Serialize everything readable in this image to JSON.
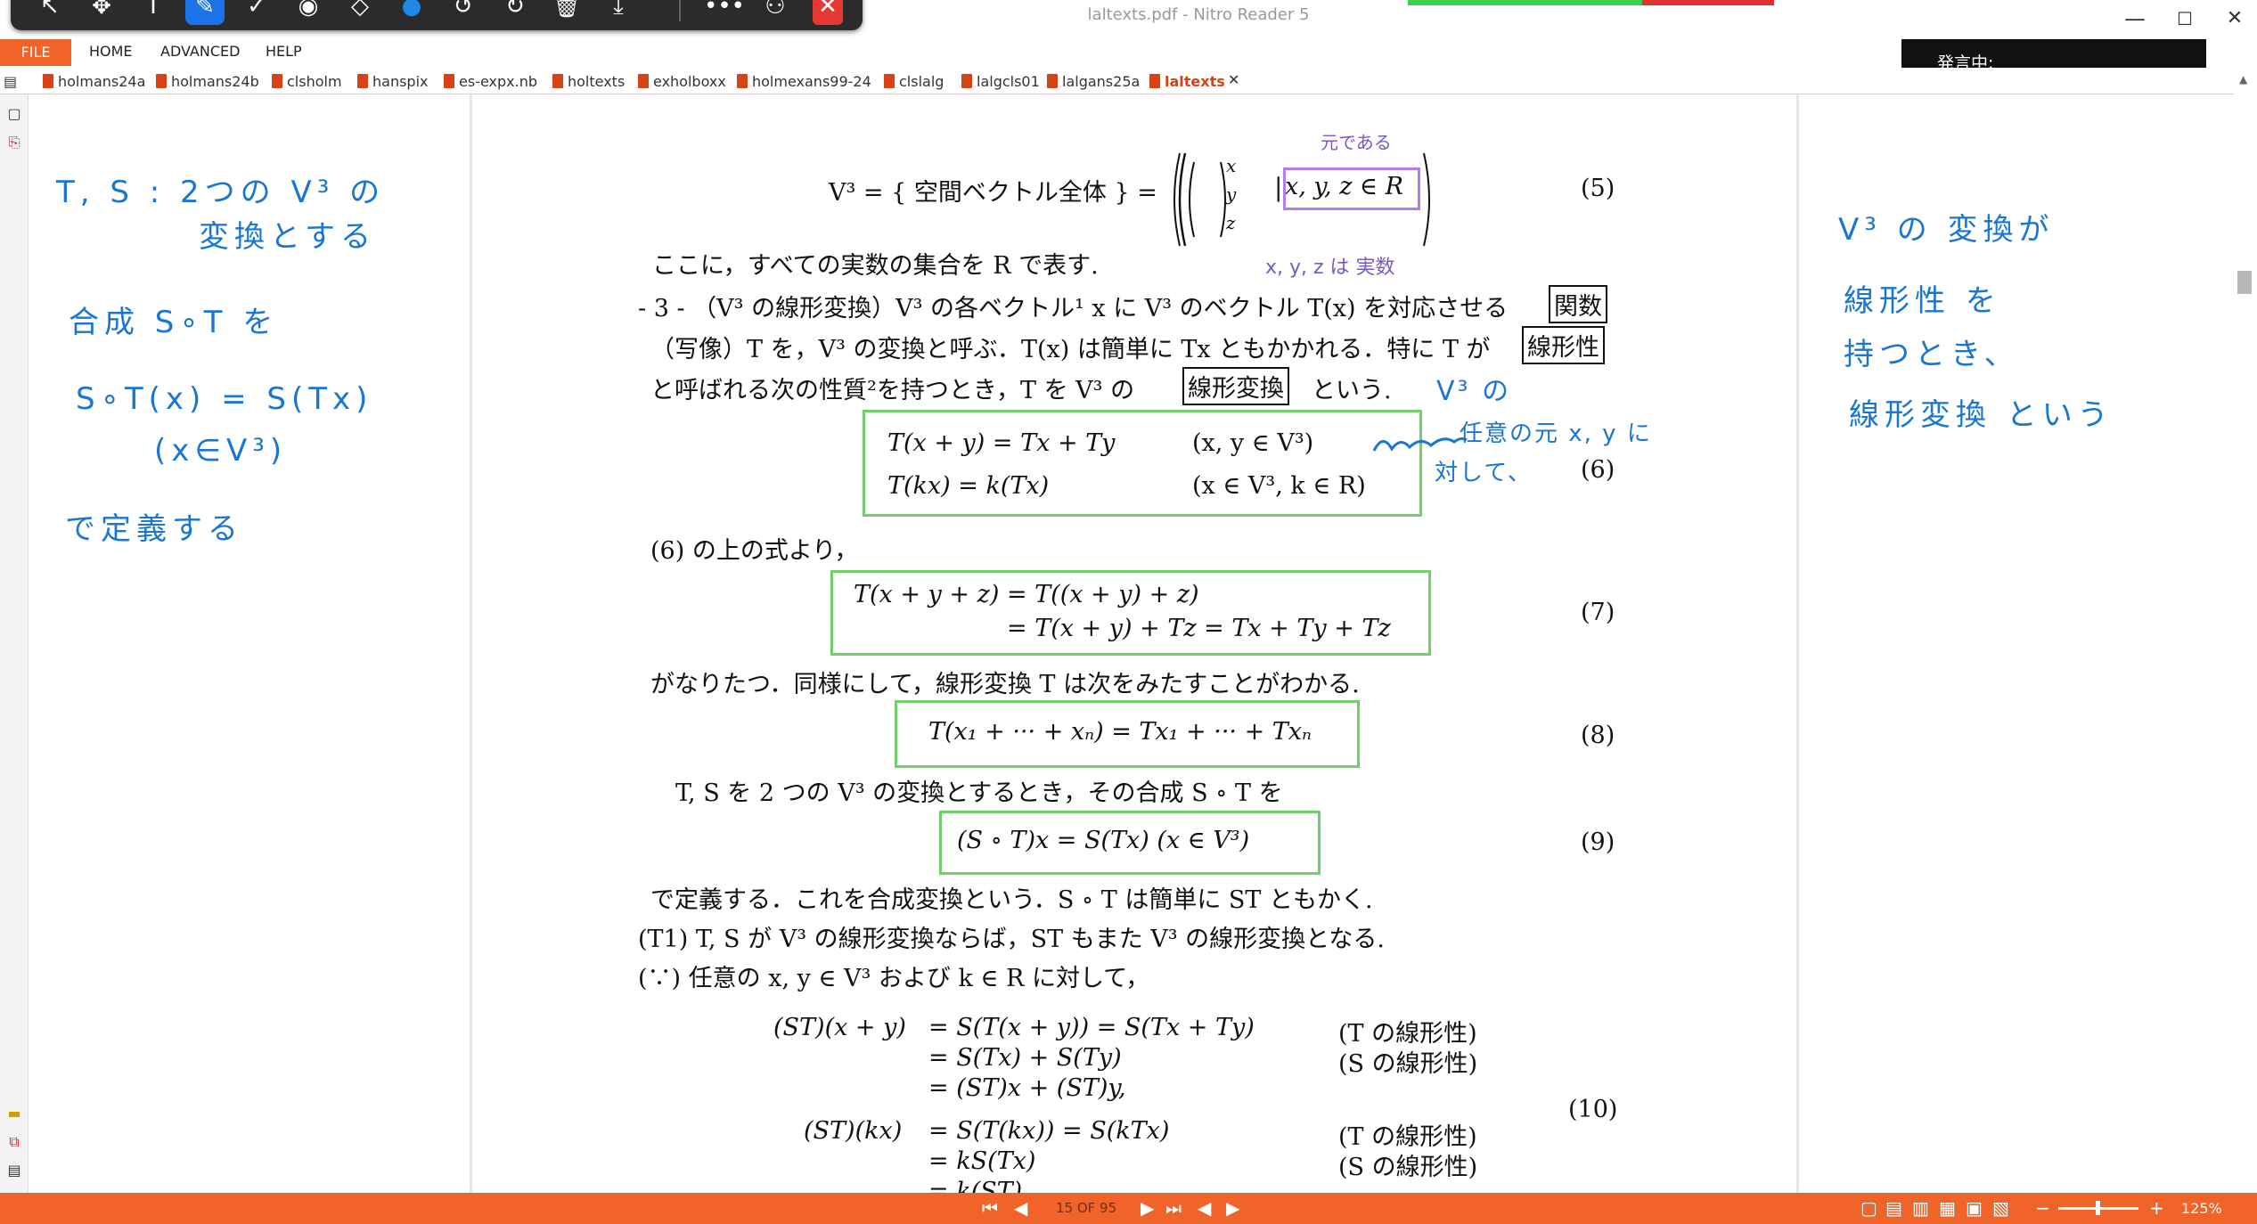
{
  "window": {
    "title": "laltexts.pdf - Nitro Reader 5",
    "minimize": "—",
    "maximize": "☐",
    "close": "✕"
  },
  "draw_toolbar": {
    "icons": [
      "pointer-icon",
      "move-icon",
      "text-cursor-icon",
      "pen-icon",
      "check-icon",
      "stamp-icon",
      "eraser-icon",
      "color-dot-icon",
      "undo-icon",
      "redo-icon",
      "delete-icon",
      "download-icon",
      "more-icon",
      "share-icon",
      "close-icon"
    ]
  },
  "menu": {
    "file": "FILE",
    "home": "HOME",
    "advanced": "ADVANCED",
    "help": "HELP"
  },
  "banner": "発言中:",
  "tabs": [
    "holmans24a",
    "holmans24b",
    "clsholm",
    "hanspix",
    "es-expx.nb",
    "holtexts",
    "exholboxx",
    "holmexans99-24",
    "clslalg",
    "lalgcls01",
    "lalgans25a",
    "laltexts"
  ],
  "page": {
    "eq5_lhs": "V³ = { 空間ベクトル全体 } =",
    "eq5_vec": [
      "x",
      "y",
      "z"
    ],
    "eq5_cond": "x, y, z ∈ R",
    "eq5_no": "(5)",
    "line1": "ここに，すべての実数の集合を R で表す.",
    "line2_pre": "- 3 - （V³ の線形変換）V³ の各ベクトル¹ x に V³ のベクトル T(x) を対応させる",
    "box_kansu": "関数",
    "line3_pre": "（写像）T を，V³ の変換と呼ぶ．T(x) は簡単に Tx ともかかれる．特に T が",
    "box_senkeisei": "線形性",
    "line4_pre": "と呼ばれる次の性質²を持つとき，T を V³ の",
    "box_henkan": "線形変換",
    "line4_post": "という.",
    "eq6a": "T(x + y) = Tx + Ty",
    "eq6a_c": "(x, y ∈ V³)",
    "eq6b": "T(kx) = k(Tx)",
    "eq6b_c": "(x ∈ V³, k ∈ R)",
    "eq6_no": "(6)",
    "line5": "(6) の上の式より，",
    "eq7a": "T(x + y + z) =   T((x + y) + z)",
    "eq7b": "=   T(x + y) + Tz = Tx + Ty + Tz",
    "eq7_no": "(7)",
    "line6": "がなりたつ．同様にして，線形変換 T は次をみたすことがわかる.",
    "eq8": "T(x₁ + ··· + xₙ) = Tx₁ + ··· + Txₙ",
    "eq8_no": "(8)",
    "line7": "T, S を 2 つの V³ の変換とするとき，その合成 S ∘ T を",
    "eq9": "(S ∘ T)x = S(Tx)       (x ∈ V³)",
    "eq9_no": "(9)",
    "line8": "で定義する．これを合成変換という．S ∘ T は簡単に ST ともかく.",
    "line9": "(T1) T, S が V³ の線形変換ならば，ST もまた V³ の線形変換となる.",
    "line10": "(∵) 任意の x, y ∈ V³ および k ∈ R に対して，",
    "eq10_l1": "(ST)(x + y)",
    "eq10_r1": "= S(T(x + y)) = S(Tx + Ty)",
    "eq10_n1": "(T の線形性)",
    "eq10_r2": "= S(Tx) + S(Ty)",
    "eq10_n2": "(S の線形性)",
    "eq10_r3": "= (ST)x + (ST)y,",
    "eq10_l4": "(ST)(kx)",
    "eq10_r4": "= S(T(kx)) = S(kTx)",
    "eq10_n4": "(T の線形性)",
    "eq10_r5": "= kS(Tx)",
    "eq10_n5": "(S の線形性)",
    "eq10_r6": "= k(ST)",
    "eq10_no": "(10)"
  },
  "handwriting_left": [
    "T, S : 2つの V³ の",
    "変換とする",
    "合成  S∘T を",
    "S∘T(x) = S(Tx)",
    "(x∈V³)",
    "で定義する"
  ],
  "handwriting_right": [
    "V³ の 変換が",
    "線形性 を",
    "持つとき、",
    "線形変換 という"
  ],
  "handwriting_page": {
    "purple_top": "元である",
    "purple_bottom": "x, y, z は 実数",
    "blue_a": "V³ の",
    "blue_b": "任意の元 x, y に",
    "blue_c": "対して、"
  },
  "status": {
    "first": "⏮",
    "prev": "◀",
    "page_indicator": "15 OF 95",
    "next": "▶",
    "last": "⏭",
    "zoom": "125%",
    "zoom_minus": "−",
    "zoom_plus": "+"
  },
  "colors": {
    "accent": "#f0642a",
    "annotation_blue": "#1976d2",
    "annotation_purple": "#7e57c2",
    "box_green": "#6fcf6a"
  }
}
